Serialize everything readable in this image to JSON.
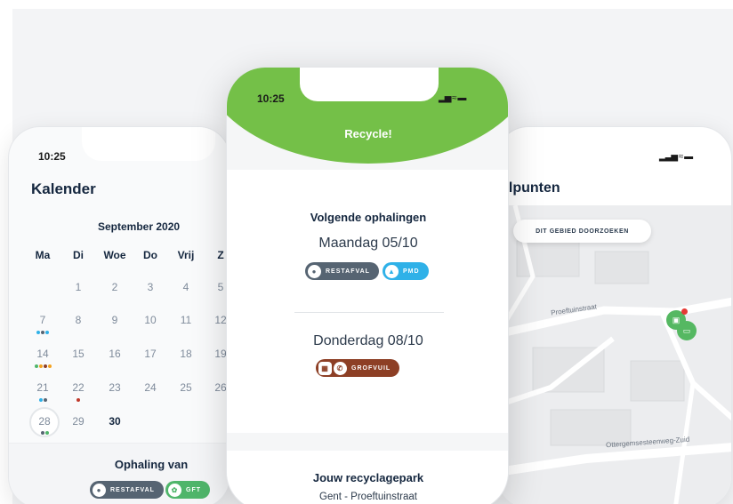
{
  "left_phone": {
    "time": "10:25",
    "title": "Kalender",
    "month": "September 2020",
    "weekdays": [
      "Ma",
      "Di",
      "Woe",
      "Do",
      "Vrij",
      "Z"
    ],
    "rows": [
      [
        "",
        "1",
        "2",
        "3",
        "4",
        "5"
      ],
      [
        "7",
        "8",
        "9",
        "10",
        "11",
        "12"
      ],
      [
        "14",
        "15",
        "16",
        "17",
        "18",
        "19"
      ],
      [
        "21",
        "22",
        "23",
        "24",
        "25",
        "26"
      ],
      [
        "28",
        "29",
        "30",
        "",
        "",
        ""
      ]
    ],
    "ophaling_title": "Ophaling van",
    "pills": [
      {
        "label": "RESTAFVAL",
        "icon": "bin-icon"
      },
      {
        "label": "GFT",
        "icon": "leaf-icon"
      }
    ]
  },
  "center_phone": {
    "time": "10:25",
    "header_title": "Recycle!",
    "section_title": "Volgende ophalingen",
    "pickups": [
      {
        "date": "Maandag 05/10",
        "pills": [
          {
            "label": "RESTAFVAL",
            "icon": "bin-icon"
          },
          {
            "label": "PMD",
            "icon": "bottle-icon"
          }
        ]
      },
      {
        "date": "Donderdag 08/10",
        "pills": [
          {
            "label": "GROFVUIL",
            "icon": "phone-icon"
          }
        ]
      }
    ],
    "park_title": "Jouw recyclagepark",
    "park_location": "Gent - Proeftuinstraat"
  },
  "right_phone": {
    "title": "elpunten",
    "search_area_button": "DIT GEBIED DOORZOEKEN",
    "streets": [
      "Proeftuinstraat",
      "Ottergemsesteenweg-Zuid"
    ]
  },
  "colors": {
    "green_header": "#74c048",
    "navy_text": "#15273f",
    "restafval": "#566472",
    "pmd": "#2fb1e8",
    "gft": "#4fb56a",
    "grofvuil": "#8d3f25"
  }
}
